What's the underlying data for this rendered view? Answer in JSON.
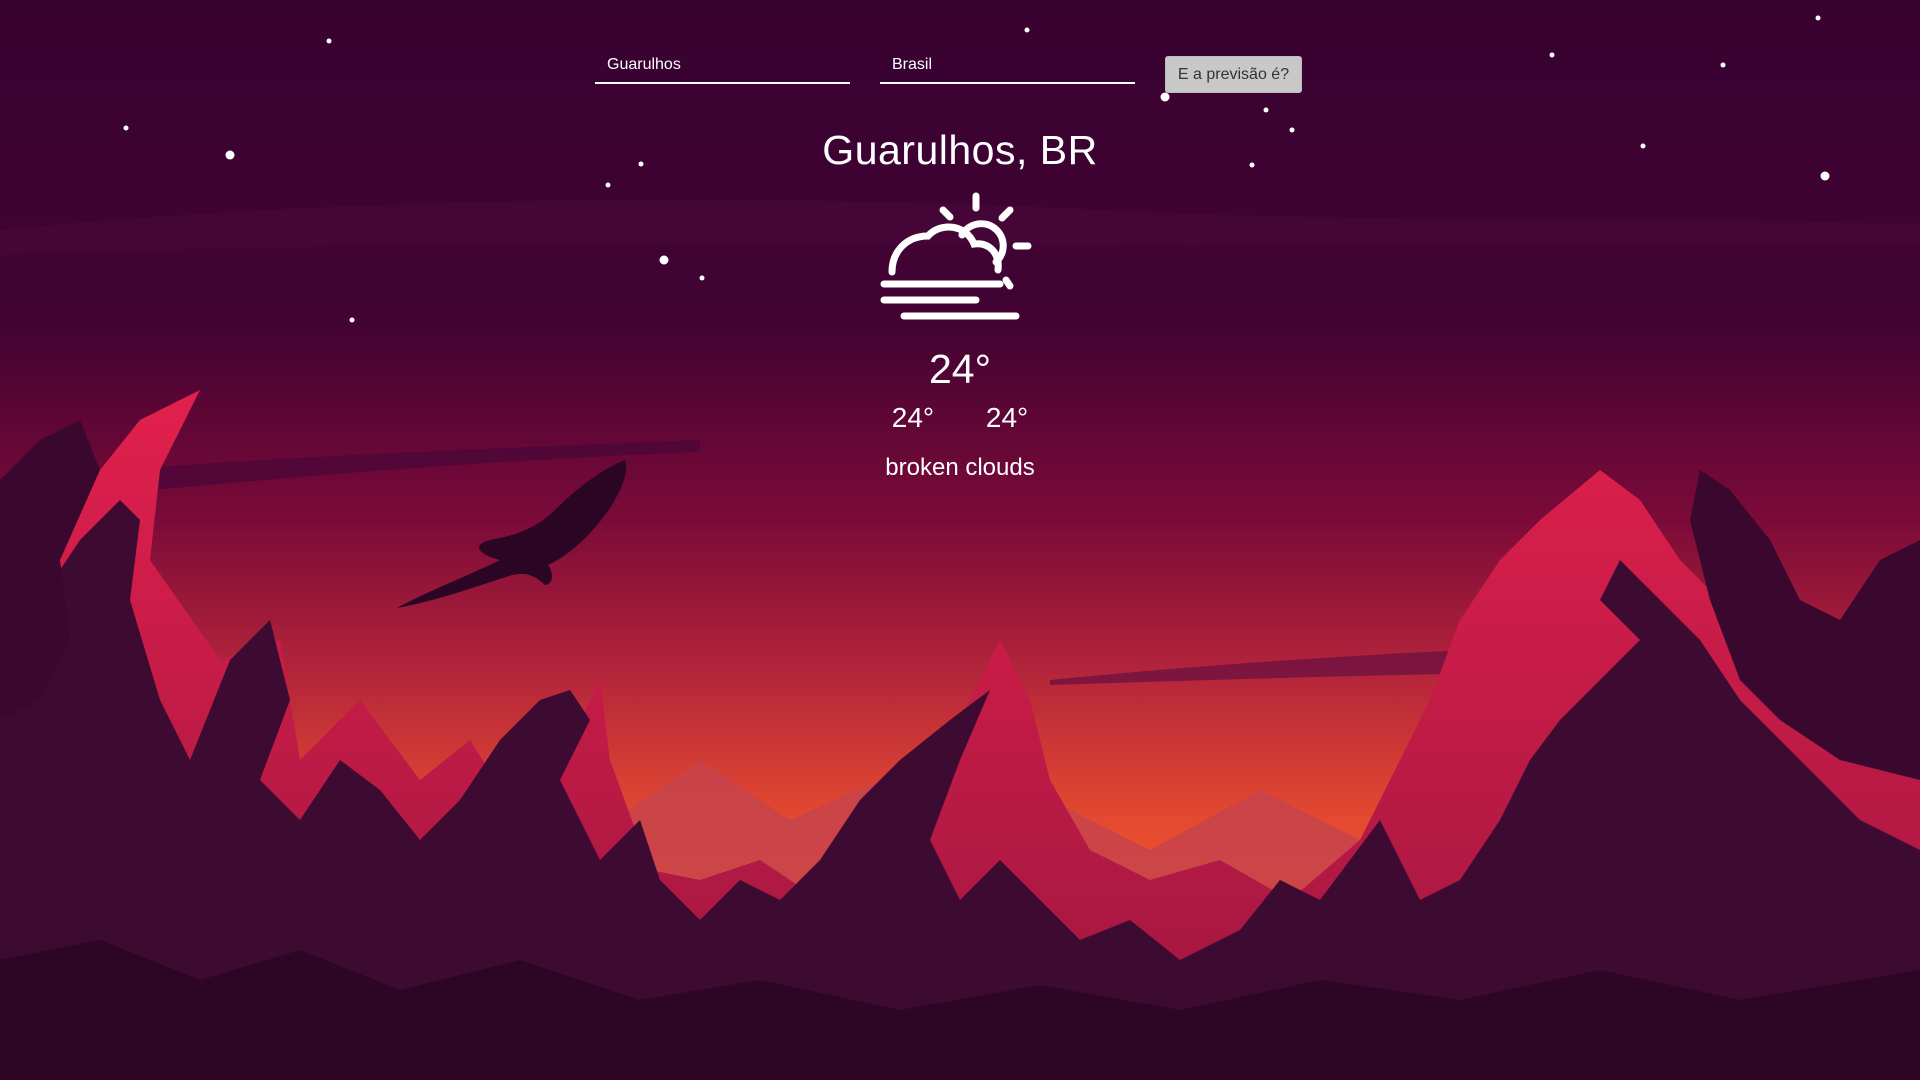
{
  "search": {
    "city_value": "Guarulhos",
    "country_value": "Brasil",
    "submit_label": "E a previsão é?"
  },
  "weather": {
    "location": "Guarulhos, BR",
    "icon": "sun-behind-cloud-fog-icon",
    "temperature": "24°",
    "temp_min": "24°",
    "temp_max": "24°",
    "description": "broken clouds"
  },
  "colors": {
    "sky_top": "#3a0230",
    "glow": "#f0542c",
    "mountain_far": "#c9404a",
    "mountain_red": "#d81f4a",
    "mountain_dark": "#3c0a30",
    "text": "#ffffff",
    "button_bg": "#c8c8c8",
    "button_text": "#333333"
  }
}
